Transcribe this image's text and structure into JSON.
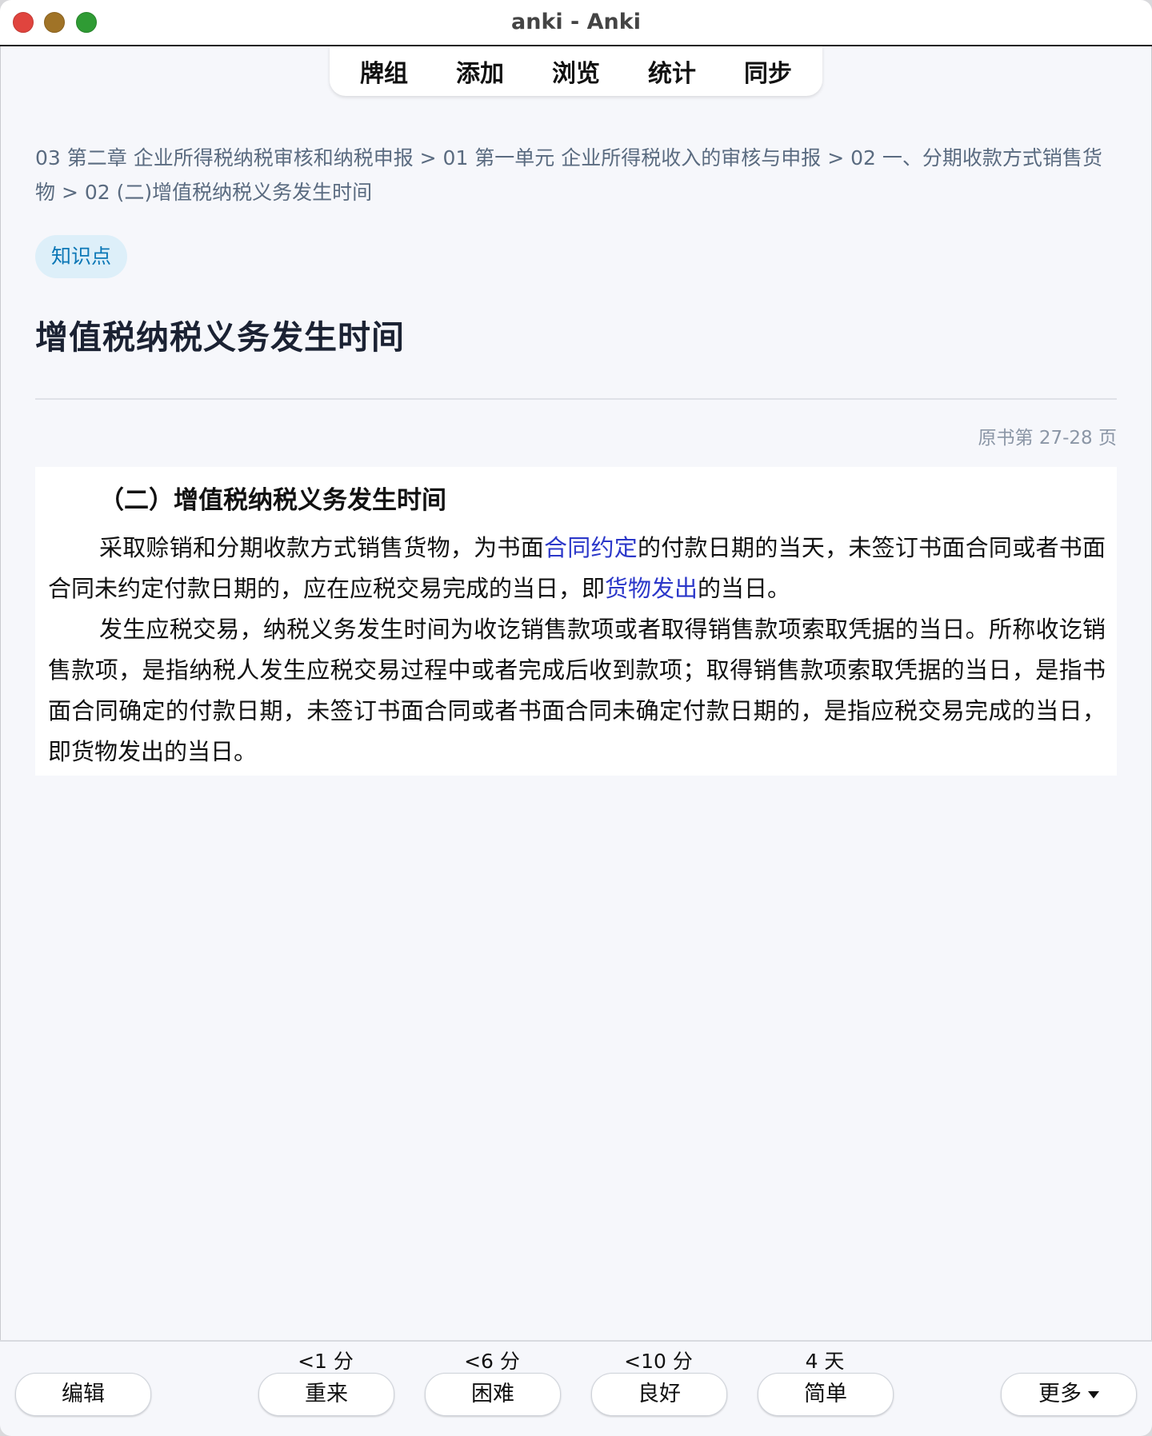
{
  "window": {
    "title": "anki - Anki"
  },
  "toolbar": {
    "tabs": [
      {
        "label": "牌组"
      },
      {
        "label": "添加"
      },
      {
        "label": "浏览"
      },
      {
        "label": "统计"
      },
      {
        "label": "同步"
      }
    ]
  },
  "card": {
    "breadcrumb": "03 第二章 企业所得税纳税审核和纳税申报 > 01 第一单元 企业所得税收入的审核与申报 > 02 一、分期收款方式销售货物 > 02 (二)增值税纳税义务发生时间",
    "tag": "知识点",
    "title": "增值税纳税义务发生时间",
    "page_ref": "原书第 27-28 页",
    "excerpt": {
      "heading": "（二）增值税纳税义务发生时间",
      "p1_a": "采取赊销和分期收款方式销售货物，为书面",
      "p1_hl1": "合同约定",
      "p1_b": "的付款日期的当天，未签订书面合同或者书面合同未约定付款日期的，应在应税交易完成的当日，即",
      "p1_hl2": "货物发出",
      "p1_c": "的当日。",
      "p2": "发生应税交易，纳税义务发生时间为收讫销售款项或者取得销售款项索取凭据的当日。所称收讫销售款项，是指纳税人发生应税交易过程中或者完成后收到款项；取得销售款项索取凭据的当日，是指书面合同确定的付款日期，未签订书面合同或者书面合同未确定付款日期的，是指应税交易完成的当日，即货物发出的当日。",
      "highlight_color": "#2b37c9"
    }
  },
  "answer_bar": {
    "edit_label": "编辑",
    "more_label": "更多",
    "buttons": [
      {
        "interval": "<1 分",
        "label": "重来"
      },
      {
        "interval": "<6 分",
        "label": "困难"
      },
      {
        "interval": "<10 分",
        "label": "良好"
      },
      {
        "interval": "4 天",
        "label": "简单"
      }
    ]
  }
}
